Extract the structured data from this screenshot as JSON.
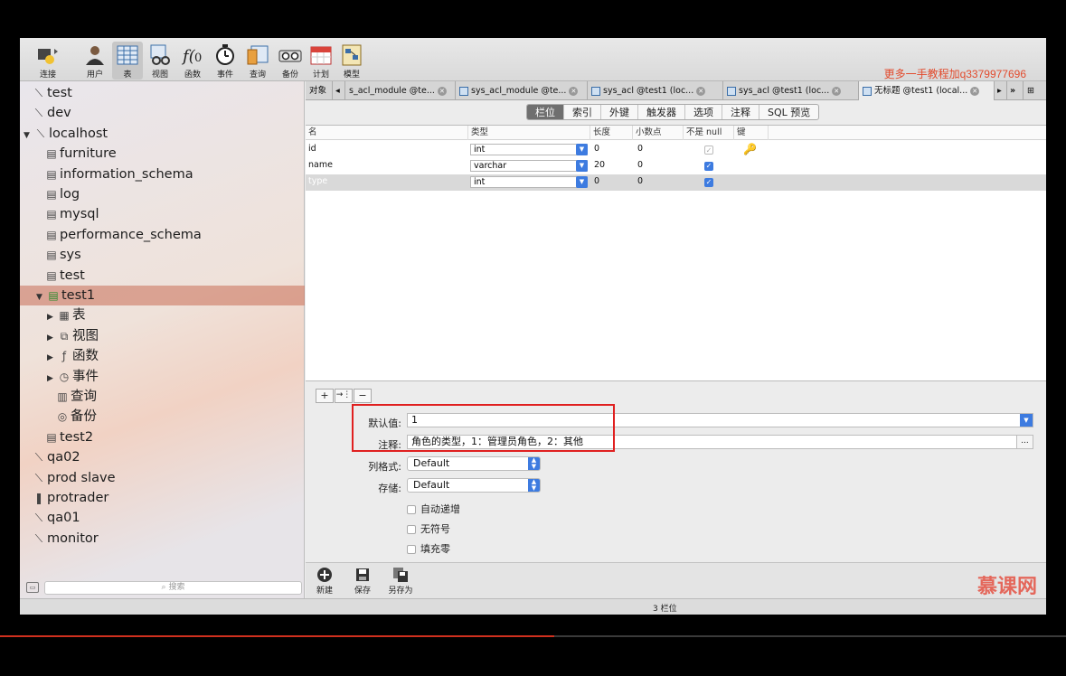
{
  "toolbar": {
    "items": [
      {
        "label": "连接",
        "icon": "connection-icon"
      },
      {
        "label": "用户",
        "icon": "user-icon"
      },
      {
        "label": "表",
        "icon": "table-icon"
      },
      {
        "label": "视图",
        "icon": "view-icon"
      },
      {
        "label": "函数",
        "icon": "function-icon"
      },
      {
        "label": "事件",
        "icon": "event-icon"
      },
      {
        "label": "查询",
        "icon": "query-icon"
      },
      {
        "label": "备份",
        "icon": "backup-icon"
      },
      {
        "label": "计划",
        "icon": "schedule-icon"
      },
      {
        "label": "模型",
        "icon": "model-icon"
      }
    ],
    "watermark": "更多一手教程加q3379977696"
  },
  "sidebar": {
    "items": [
      {
        "label": "test",
        "kind": "conn"
      },
      {
        "label": "dev",
        "kind": "conn"
      },
      {
        "label": "localhost",
        "kind": "conn-open"
      },
      {
        "label": "furniture",
        "kind": "db"
      },
      {
        "label": "information_schema",
        "kind": "db"
      },
      {
        "label": "log",
        "kind": "db"
      },
      {
        "label": "mysql",
        "kind": "db"
      },
      {
        "label": "performance_schema",
        "kind": "db"
      },
      {
        "label": "sys",
        "kind": "db"
      },
      {
        "label": "test",
        "kind": "db"
      },
      {
        "label": "test1",
        "kind": "db-open"
      },
      {
        "label": "表",
        "kind": "folder-table"
      },
      {
        "label": "视图",
        "kind": "folder-view"
      },
      {
        "label": "函数",
        "kind": "folder-func"
      },
      {
        "label": "事件",
        "kind": "folder-event"
      },
      {
        "label": "查询",
        "kind": "leaf-query"
      },
      {
        "label": "备份",
        "kind": "leaf-backup"
      },
      {
        "label": "test2",
        "kind": "db"
      },
      {
        "label": "qa02",
        "kind": "conn"
      },
      {
        "label": "prod slave",
        "kind": "conn"
      },
      {
        "label": "protrader",
        "kind": "conn-alt"
      },
      {
        "label": "qa01",
        "kind": "conn"
      },
      {
        "label": "monitor",
        "kind": "conn"
      }
    ],
    "search_placeholder": "搜索"
  },
  "tabs": [
    {
      "label": "对象"
    },
    {
      "label": "s_acl_module @te..."
    },
    {
      "label": "sys_acl_module @te..."
    },
    {
      "label": "sys_acl @test1 (loc..."
    },
    {
      "label": "sys_acl @test1 (loc..."
    },
    {
      "label": "无标题 @test1 (local..."
    }
  ],
  "subtabs": [
    "栏位",
    "索引",
    "外键",
    "触发器",
    "选项",
    "注释",
    "SQL 预览"
  ],
  "grid": {
    "headers": [
      "名",
      "类型",
      "长度",
      "小数点",
      "不是 null",
      "键"
    ],
    "rows": [
      {
        "name": "id",
        "type": "int",
        "length": "0",
        "decimals": "0",
        "not_null": true,
        "key": true
      },
      {
        "name": "name",
        "type": "varchar",
        "length": "20",
        "decimals": "0",
        "not_null": true,
        "key": false
      },
      {
        "name": "type",
        "type": "int",
        "length": "0",
        "decimals": "0",
        "not_null": true,
        "key": false
      }
    ]
  },
  "field_props": {
    "default_label": "默认值:",
    "default_value": "1",
    "comment_label": "注释:",
    "comment_value": "角色的类型，1：管理员角色，2：其他",
    "column_format_label": "列格式:",
    "column_format_value": "Default",
    "storage_label": "存储:",
    "storage_value": "Default",
    "auto_increment": "自动递增",
    "unsigned": "无符号",
    "zerofill": "填充零"
  },
  "bottom": {
    "new": "新建",
    "save": "保存",
    "save_as": "另存为",
    "logo": "慕课网"
  },
  "status": {
    "text": "3 栏位"
  },
  "video_progress": 0.52,
  "colors": {
    "accent": "#3d7be0",
    "highlight": "#e02020"
  }
}
